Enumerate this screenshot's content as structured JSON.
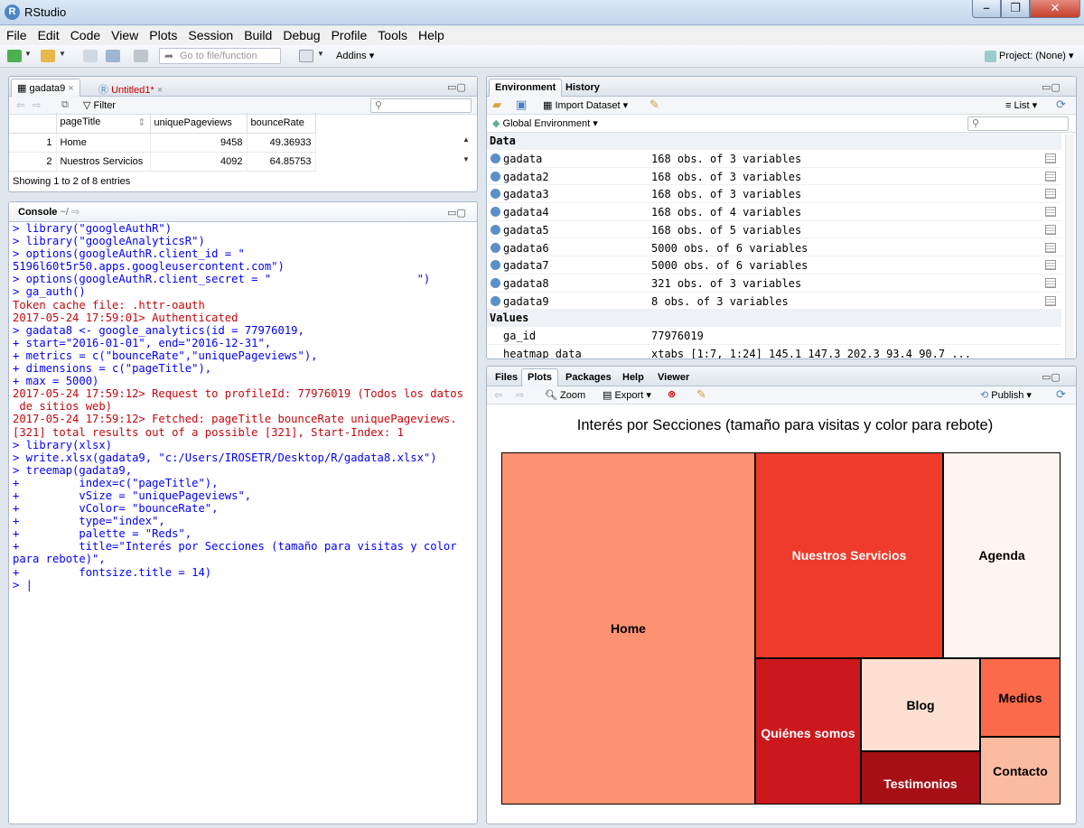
{
  "window": {
    "title": "RStudio",
    "app_icon": "R"
  },
  "menu": [
    "File",
    "Edit",
    "Code",
    "View",
    "Plots",
    "Session",
    "Build",
    "Debug",
    "Profile",
    "Tools",
    "Help"
  ],
  "toolbar": {
    "goto_placeholder": "Go to file/function",
    "addins": "Addins",
    "project": "Project: (None)"
  },
  "source": {
    "tabs": [
      "gadata9",
      "Untitled1*"
    ],
    "filter": "Filter",
    "columns": [
      "",
      "pageTitle",
      "uniquePageviews",
      "bounceRate"
    ],
    "rows": [
      [
        "1",
        "Home",
        "9458",
        "49.36933"
      ],
      [
        "2",
        "Nuestros Servicios",
        "4092",
        "64.85753"
      ]
    ],
    "status": "Showing 1 to 2 of 8 entries"
  },
  "console": {
    "title": "Console",
    "path": "~/",
    "lines": [
      {
        "t": "in",
        "s": "> library(\"googleAuthR\")"
      },
      {
        "t": "in",
        "s": "> library(\"googleAnalyticsR\")"
      },
      {
        "t": "in",
        "s": "> options(googleAuthR.client_id = \""
      },
      {
        "t": "in",
        "s": "5196l60t5r50.apps.googleusercontent.com\")"
      },
      {
        "t": "in",
        "s": "> options(googleAuthR.client_secret = \"                      \")"
      },
      {
        "t": "in",
        "s": "> ga_auth()"
      },
      {
        "t": "out",
        "s": "Token cache file: .httr-oauth"
      },
      {
        "t": "out",
        "s": "2017-05-24 17:59:01> Authenticated"
      },
      {
        "t": "in",
        "s": "> gadata8 <- google_analytics(id = 77976019,"
      },
      {
        "t": "in",
        "s": "+ start=\"2016-01-01\", end=\"2016-12-31\","
      },
      {
        "t": "in",
        "s": "+ metrics = c(\"bounceRate\",\"uniquePageviews\"),"
      },
      {
        "t": "in",
        "s": "+ dimensions = c(\"pageTitle\"),"
      },
      {
        "t": "in",
        "s": "+ max = 5000)"
      },
      {
        "t": "out",
        "s": "2017-05-24 17:59:12> Request to profileId: 77976019 (Todos los datos"
      },
      {
        "t": "out",
        "s": " de sitios web)"
      },
      {
        "t": "out",
        "s": "2017-05-24 17:59:12> Fetched: pageTitle bounceRate uniquePageviews."
      },
      {
        "t": "out",
        "s": "[321] total results out of a possible [321], Start-Index: 1"
      },
      {
        "t": "in",
        "s": "> library(xlsx)"
      },
      {
        "t": "in",
        "s": "> write.xlsx(gadata9, \"c:/Users/IROSETR/Desktop/R/gadata8.xlsx\")"
      },
      {
        "t": "in",
        "s": "> treemap(gadata9,"
      },
      {
        "t": "in",
        "s": "+         index=c(\"pageTitle\"),"
      },
      {
        "t": "in",
        "s": "+         vSize = \"uniquePageviews\","
      },
      {
        "t": "in",
        "s": "+         vColor= \"bounceRate\","
      },
      {
        "t": "in",
        "s": "+         type=\"index\","
      },
      {
        "t": "in",
        "s": "+         palette = \"Reds\","
      },
      {
        "t": "in",
        "s": "+         title=\"Interés por Secciones (tamaño para visitas y color"
      },
      {
        "t": "in",
        "s": "para rebote)\","
      },
      {
        "t": "in",
        "s": "+         fontsize.title = 14)"
      },
      {
        "t": "in",
        "s": "> |"
      }
    ]
  },
  "environment": {
    "tabs": [
      "Environment",
      "History"
    ],
    "import_dataset": "Import Dataset",
    "view_mode": "List",
    "scope": "Global Environment",
    "data_header": "Data",
    "data": [
      {
        "name": "gadata",
        "value": "168 obs. of 3 variables"
      },
      {
        "name": "gadata2",
        "value": "168 obs. of 3 variables"
      },
      {
        "name": "gadata3",
        "value": "168 obs. of 3 variables"
      },
      {
        "name": "gadata4",
        "value": "168 obs. of 4 variables"
      },
      {
        "name": "gadata5",
        "value": "168 obs. of 5 variables"
      },
      {
        "name": "gadata6",
        "value": "5000 obs. of 6 variables"
      },
      {
        "name": "gadata7",
        "value": "5000 obs. of 6 variables"
      },
      {
        "name": "gadata8",
        "value": "321 obs. of 3 variables"
      },
      {
        "name": "gadata9",
        "value": "8 obs. of 3 variables"
      }
    ],
    "values_header": "Values",
    "values": [
      {
        "name": "ga_id",
        "value": "77976019"
      },
      {
        "name": "heatmap_data",
        "value": "xtabs [1:7, 1:24] 145.1 147.3 202.3 93.4 90.7 ..."
      }
    ]
  },
  "files_pane": {
    "tabs": [
      "Files",
      "Plots",
      "Packages",
      "Help",
      "Viewer"
    ],
    "zoom": "Zoom",
    "export": "Export",
    "publish": "Publish"
  },
  "plot": {
    "title": "Interés por Secciones (tamaño para visitas y color para rebote)",
    "cells": [
      {
        "label": "Home",
        "color": "#fc9272"
      },
      {
        "label": "Nuestros Servicios",
        "color": "#ef3b2c",
        "fg": "#ffffff"
      },
      {
        "label": "Agenda",
        "color": "#fff5f0"
      },
      {
        "label": "Quiénes somos",
        "color": "#cb181d",
        "fg": "#ffffff"
      },
      {
        "label": "Blog",
        "color": "#fee0d2"
      },
      {
        "label": "Medios",
        "color": "#fb6a4a"
      },
      {
        "label": "Testimonios",
        "color": "#a50f15",
        "fg": "#ffffff"
      },
      {
        "label": "Contacto",
        "color": "#fcbba1"
      }
    ]
  }
}
